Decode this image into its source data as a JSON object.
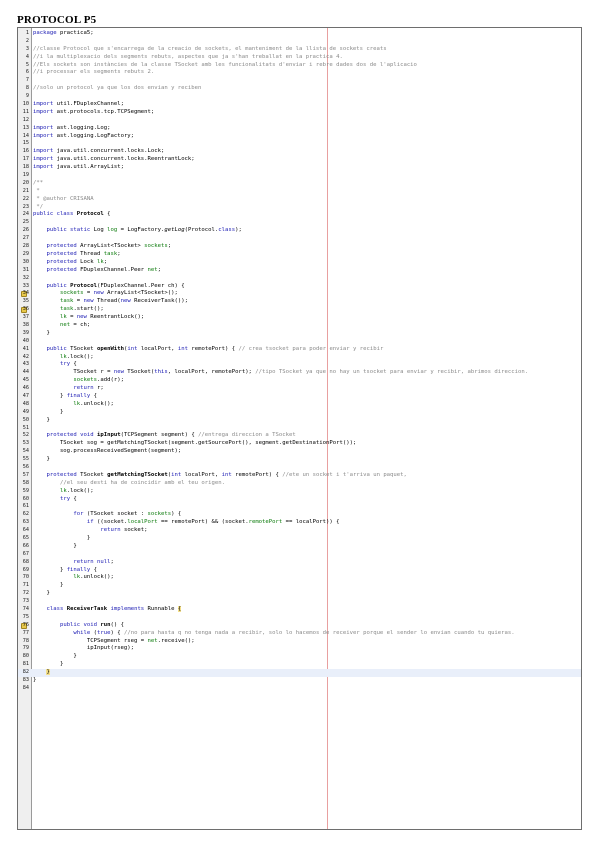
{
  "document": {
    "title": "PROTOCOL P5"
  },
  "editor": {
    "lines": [
      {
        "n": "1",
        "parts": [
          {
            "t": "package",
            "c": "kw"
          },
          {
            "t": " practica5;"
          }
        ]
      },
      {
        "n": "2",
        "parts": []
      },
      {
        "n": "3",
        "parts": [
          {
            "t": "//classe Protocol que s'encarrega de la creacio de sockets, el manteniment de la llista de sockets creats",
            "c": "cm"
          }
        ]
      },
      {
        "n": "4",
        "parts": [
          {
            "t": "//i la multiplexacio dels segments rebuts, aspectes que ja s'han treballat en la practica 4.",
            "c": "cm"
          }
        ]
      },
      {
        "n": "5",
        "parts": [
          {
            "t": "//Els sockets son instàncies de la classe TSocket amb les funcionalitats d'enviar i rebre dades dos de l'aplicacio",
            "c": "cm"
          }
        ]
      },
      {
        "n": "6",
        "parts": [
          {
            "t": "//i processar els segments rebuts 2.",
            "c": "cm"
          }
        ]
      },
      {
        "n": "7",
        "parts": []
      },
      {
        "n": "8",
        "parts": [
          {
            "t": "//solo un protocol ya que los dos envian y reciben",
            "c": "cm"
          }
        ]
      },
      {
        "n": "9",
        "parts": []
      },
      {
        "n": "10",
        "parts": [
          {
            "t": "import",
            "c": "kw"
          },
          {
            "t": " util.FDuplexChannel;"
          }
        ]
      },
      {
        "n": "11",
        "parts": [
          {
            "t": "import",
            "c": "kw"
          },
          {
            "t": " ast.protocols.tcp.TCPSegment;"
          }
        ]
      },
      {
        "n": "12",
        "parts": []
      },
      {
        "n": "13",
        "parts": [
          {
            "t": "import",
            "c": "kw"
          },
          {
            "t": " ast.logging.Log;"
          }
        ]
      },
      {
        "n": "14",
        "parts": [
          {
            "t": "import",
            "c": "kw"
          },
          {
            "t": " ast.logging.LogFactory;"
          }
        ]
      },
      {
        "n": "15",
        "parts": []
      },
      {
        "n": "16",
        "parts": [
          {
            "t": "import",
            "c": "kw"
          },
          {
            "t": " java.util.concurrent.locks.Lock;"
          }
        ]
      },
      {
        "n": "17",
        "parts": [
          {
            "t": "import",
            "c": "kw"
          },
          {
            "t": " java.util.concurrent.locks.ReentrantLock;"
          }
        ]
      },
      {
        "n": "18",
        "parts": [
          {
            "t": "import",
            "c": "kw"
          },
          {
            "t": " java.util.ArrayList;"
          }
        ]
      },
      {
        "n": "19",
        "parts": []
      },
      {
        "n": "20",
        "parts": [
          {
            "t": "/**",
            "c": "cm"
          }
        ]
      },
      {
        "n": "21",
        "parts": [
          {
            "t": " *",
            "c": "cm"
          }
        ]
      },
      {
        "n": "22",
        "parts": [
          {
            "t": " * @author CRISANA",
            "c": "cm"
          }
        ]
      },
      {
        "n": "23",
        "parts": [
          {
            "t": " */",
            "c": "cm"
          }
        ]
      },
      {
        "n": "24",
        "parts": [
          {
            "t": "public class",
            "c": "kw"
          },
          {
            "t": " "
          },
          {
            "t": "Protocol",
            "c": "bold"
          },
          {
            "t": " {"
          }
        ]
      },
      {
        "n": "25",
        "parts": []
      },
      {
        "n": "26",
        "parts": [
          {
            "t": "    "
          },
          {
            "t": "public static",
            "c": "kw"
          },
          {
            "t": " Log "
          },
          {
            "t": "log",
            "c": "fld"
          },
          {
            "t": " = LogFactory."
          },
          {
            "t": "getLog",
            "c": "ital"
          },
          {
            "t": "(Protocol."
          },
          {
            "t": "class",
            "c": "kw"
          },
          {
            "t": ");"
          }
        ]
      },
      {
        "n": "27",
        "parts": []
      },
      {
        "n": "28",
        "parts": [
          {
            "t": "    "
          },
          {
            "t": "protected",
            "c": "kw"
          },
          {
            "t": " ArrayList<TSocket> "
          },
          {
            "t": "sockets",
            "c": "fld"
          },
          {
            "t": ";"
          }
        ]
      },
      {
        "n": "29",
        "parts": [
          {
            "t": "    "
          },
          {
            "t": "protected",
            "c": "kw"
          },
          {
            "t": " Thread "
          },
          {
            "t": "task",
            "c": "fld"
          },
          {
            "t": ";"
          }
        ]
      },
      {
        "n": "30",
        "parts": [
          {
            "t": "    "
          },
          {
            "t": "protected",
            "c": "kw"
          },
          {
            "t": " Lock "
          },
          {
            "t": "lk",
            "c": "fld"
          },
          {
            "t": ";"
          }
        ]
      },
      {
        "n": "31",
        "parts": [
          {
            "t": "    "
          },
          {
            "t": "protected",
            "c": "kw"
          },
          {
            "t": " FDuplexChannel.Peer "
          },
          {
            "t": "net",
            "c": "fld"
          },
          {
            "t": ";"
          }
        ]
      },
      {
        "n": "32",
        "parts": []
      },
      {
        "n": "33",
        "parts": [
          {
            "t": "    "
          },
          {
            "t": "public",
            "c": "kw"
          },
          {
            "t": " "
          },
          {
            "t": "Protocol",
            "c": "bold"
          },
          {
            "t": "(FDuplexChannel.Peer ch) {"
          }
        ]
      },
      {
        "n": "34",
        "mark": true,
        "parts": [
          {
            "t": "        "
          },
          {
            "t": "sockets",
            "c": "fld"
          },
          {
            "t": " = "
          },
          {
            "t": "new",
            "c": "kw"
          },
          {
            "t": " ArrayList<TSocket>();"
          }
        ]
      },
      {
        "n": "35",
        "parts": [
          {
            "t": "        "
          },
          {
            "t": "task",
            "c": "fld"
          },
          {
            "t": " = "
          },
          {
            "t": "new",
            "c": "kw"
          },
          {
            "t": " Thread("
          },
          {
            "t": "new",
            "c": "kw"
          },
          {
            "t": " ReceiverTask());"
          }
        ]
      },
      {
        "n": "36",
        "mark": true,
        "parts": [
          {
            "t": "        "
          },
          {
            "t": "task",
            "c": "fld"
          },
          {
            "t": ".start();"
          }
        ]
      },
      {
        "n": "37",
        "parts": [
          {
            "t": "        "
          },
          {
            "t": "lk",
            "c": "fld"
          },
          {
            "t": " = "
          },
          {
            "t": "new",
            "c": "kw"
          },
          {
            "t": " ReentrantLock();"
          }
        ]
      },
      {
        "n": "38",
        "parts": [
          {
            "t": "        "
          },
          {
            "t": "net",
            "c": "fld"
          },
          {
            "t": " = ch;"
          }
        ]
      },
      {
        "n": "39",
        "parts": [
          {
            "t": "    }"
          }
        ]
      },
      {
        "n": "40",
        "parts": []
      },
      {
        "n": "41",
        "parts": [
          {
            "t": "    "
          },
          {
            "t": "public",
            "c": "kw"
          },
          {
            "t": " TSocket "
          },
          {
            "t": "openWith",
            "c": "bold"
          },
          {
            "t": "("
          },
          {
            "t": "int",
            "c": "kw"
          },
          {
            "t": " localPort, "
          },
          {
            "t": "int",
            "c": "kw"
          },
          {
            "t": " remotePort) { "
          },
          {
            "t": "// crea tsocket para poder enviar y recibir",
            "c": "cm"
          }
        ]
      },
      {
        "n": "42",
        "parts": [
          {
            "t": "        "
          },
          {
            "t": "lk",
            "c": "fld"
          },
          {
            "t": ".lock();"
          }
        ]
      },
      {
        "n": "43",
        "parts": [
          {
            "t": "        "
          },
          {
            "t": "try",
            "c": "kw"
          },
          {
            "t": " {"
          }
        ]
      },
      {
        "n": "44",
        "parts": [
          {
            "t": "            TSocket r = "
          },
          {
            "t": "new",
            "c": "kw"
          },
          {
            "t": " TSocket("
          },
          {
            "t": "this",
            "c": "kw"
          },
          {
            "t": ", localPort, remotePort); "
          },
          {
            "t": "//tipo TSocket ya que no hay un tsocket para enviar y recibir, abrimos direccion.",
            "c": "cm"
          }
        ]
      },
      {
        "n": "45",
        "parts": [
          {
            "t": "            "
          },
          {
            "t": "sockets",
            "c": "fld"
          },
          {
            "t": ".add(r);"
          }
        ]
      },
      {
        "n": "46",
        "parts": [
          {
            "t": "            "
          },
          {
            "t": "return",
            "c": "kw"
          },
          {
            "t": " r;"
          }
        ]
      },
      {
        "n": "47",
        "parts": [
          {
            "t": "        } "
          },
          {
            "t": "finally",
            "c": "kw"
          },
          {
            "t": " {"
          }
        ]
      },
      {
        "n": "48",
        "parts": [
          {
            "t": "            "
          },
          {
            "t": "lk",
            "c": "fld"
          },
          {
            "t": ".unlock();"
          }
        ]
      },
      {
        "n": "49",
        "parts": [
          {
            "t": "        }"
          }
        ]
      },
      {
        "n": "50",
        "parts": [
          {
            "t": "    }"
          }
        ]
      },
      {
        "n": "51",
        "parts": []
      },
      {
        "n": "52",
        "parts": [
          {
            "t": "    "
          },
          {
            "t": "protected void",
            "c": "kw"
          },
          {
            "t": " "
          },
          {
            "t": "ipInput",
            "c": "bold"
          },
          {
            "t": "(TCPSegment segment) { "
          },
          {
            "t": "//entrega direccion a TSocket",
            "c": "cm"
          }
        ]
      },
      {
        "n": "53",
        "parts": [
          {
            "t": "        TSocket sog = getMatchingTSocket(segment.getSourcePort(), segment.getDestinationPort());"
          }
        ]
      },
      {
        "n": "54",
        "parts": [
          {
            "t": "        sog.processReceivedSegment(segment);"
          }
        ]
      },
      {
        "n": "55",
        "parts": [
          {
            "t": "    }"
          }
        ]
      },
      {
        "n": "56",
        "parts": []
      },
      {
        "n": "57",
        "parts": [
          {
            "t": "    "
          },
          {
            "t": "protected",
            "c": "kw"
          },
          {
            "t": " TSocket "
          },
          {
            "t": "getMatchingTSocket",
            "c": "bold"
          },
          {
            "t": "("
          },
          {
            "t": "int",
            "c": "kw"
          },
          {
            "t": " localPort, "
          },
          {
            "t": "int",
            "c": "kw"
          },
          {
            "t": " remotePort) { "
          },
          {
            "t": "//ete un socket i t'arriva un paquet,",
            "c": "cm"
          }
        ]
      },
      {
        "n": "58",
        "parts": [
          {
            "t": "        "
          },
          {
            "t": "//el seu desti ha de coincidir amb el teu origen.",
            "c": "cm"
          }
        ]
      },
      {
        "n": "59",
        "parts": [
          {
            "t": "        "
          },
          {
            "t": "lk",
            "c": "fld"
          },
          {
            "t": ".lock();"
          }
        ]
      },
      {
        "n": "60",
        "parts": [
          {
            "t": "        "
          },
          {
            "t": "try",
            "c": "kw"
          },
          {
            "t": " {"
          }
        ]
      },
      {
        "n": "61",
        "parts": []
      },
      {
        "n": "62",
        "parts": [
          {
            "t": "            "
          },
          {
            "t": "for",
            "c": "kw"
          },
          {
            "t": " (TSocket socket : "
          },
          {
            "t": "sockets",
            "c": "fld"
          },
          {
            "t": ") {"
          }
        ]
      },
      {
        "n": "63",
        "parts": [
          {
            "t": "                "
          },
          {
            "t": "if",
            "c": "kw"
          },
          {
            "t": " ((socket."
          },
          {
            "t": "localPort",
            "c": "fld"
          },
          {
            "t": " == remotePort) && (socket."
          },
          {
            "t": "remotePort",
            "c": "fld"
          },
          {
            "t": " == localPort)) {"
          }
        ]
      },
      {
        "n": "64",
        "parts": [
          {
            "t": "                    "
          },
          {
            "t": "return",
            "c": "kw"
          },
          {
            "t": " socket;"
          }
        ]
      },
      {
        "n": "65",
        "parts": [
          {
            "t": "                }"
          }
        ]
      },
      {
        "n": "66",
        "parts": [
          {
            "t": "            }"
          }
        ]
      },
      {
        "n": "67",
        "parts": []
      },
      {
        "n": "68",
        "parts": [
          {
            "t": "            "
          },
          {
            "t": "return null",
            "c": "kw"
          },
          {
            "t": ";"
          }
        ]
      },
      {
        "n": "69",
        "parts": [
          {
            "t": "        } "
          },
          {
            "t": "finally",
            "c": "kw"
          },
          {
            "t": " {"
          }
        ]
      },
      {
        "n": "70",
        "parts": [
          {
            "t": "            "
          },
          {
            "t": "lk",
            "c": "fld"
          },
          {
            "t": ".unlock();"
          }
        ]
      },
      {
        "n": "71",
        "parts": [
          {
            "t": "        }"
          }
        ]
      },
      {
        "n": "72",
        "parts": [
          {
            "t": "    }"
          }
        ]
      },
      {
        "n": "73",
        "parts": []
      },
      {
        "n": "74",
        "parts": [
          {
            "t": "    "
          },
          {
            "t": "class",
            "c": "kw"
          },
          {
            "t": " "
          },
          {
            "t": "ReceiverTask",
            "c": "bold"
          },
          {
            "t": " "
          },
          {
            "t": "implements",
            "c": "kw"
          },
          {
            "t": " Runnable "
          },
          {
            "t": "{",
            "c": "brace-hl"
          }
        ]
      },
      {
        "n": "75",
        "parts": []
      },
      {
        "n": "76",
        "mark": true,
        "parts": [
          {
            "t": "        "
          },
          {
            "t": "public void",
            "c": "kw"
          },
          {
            "t": " "
          },
          {
            "t": "run",
            "c": "bold"
          },
          {
            "t": "() {"
          }
        ]
      },
      {
        "n": "77",
        "parts": [
          {
            "t": "            "
          },
          {
            "t": "while",
            "c": "kw"
          },
          {
            "t": " ("
          },
          {
            "t": "true",
            "c": "kw"
          },
          {
            "t": ") { "
          },
          {
            "t": "//no para hasta q no tenga nada a recibir, solo lo hacemos de receiver porque el sender lo envian cuando tu quieras.",
            "c": "cm"
          }
        ]
      },
      {
        "n": "78",
        "parts": [
          {
            "t": "                TCPSegment rseg = "
          },
          {
            "t": "net",
            "c": "fld"
          },
          {
            "t": ".receive();"
          }
        ]
      },
      {
        "n": "79",
        "parts": [
          {
            "t": "                ipInput(rseg);"
          }
        ]
      },
      {
        "n": "80",
        "parts": [
          {
            "t": "            }"
          }
        ]
      },
      {
        "n": "81",
        "parts": [
          {
            "t": "        }"
          }
        ]
      },
      {
        "n": "82",
        "current": true,
        "parts": [
          {
            "t": "    "
          },
          {
            "t": "}",
            "c": "brace-hl"
          }
        ]
      },
      {
        "n": "83",
        "parts": [
          {
            "t": "}"
          }
        ]
      },
      {
        "n": "84",
        "parts": []
      }
    ]
  }
}
